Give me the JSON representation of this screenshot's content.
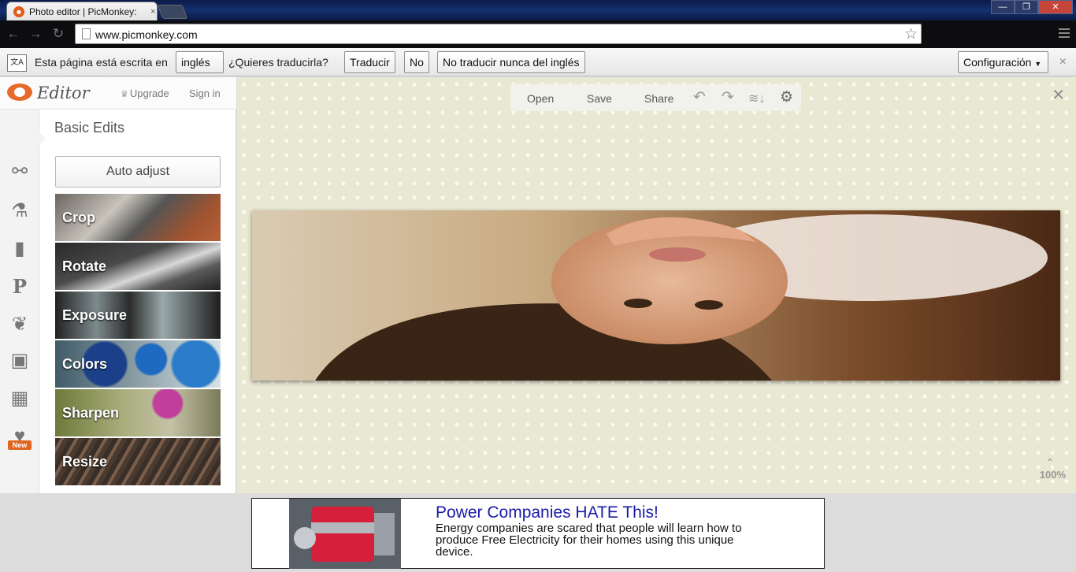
{
  "browser": {
    "tab_title": "Photo editor | PicMonkey:",
    "tab_close": "×",
    "url": "www.picmonkey.com",
    "window_buttons": [
      "—",
      "❐",
      "✕"
    ]
  },
  "translate_bar": {
    "prefix": "Esta página está escrita en",
    "language": "inglés",
    "question": "¿Quieres traducirla?",
    "translate_button": "Traducir",
    "no_button": "No",
    "never_button": "No traducir nunca del inglés",
    "settings_button": "Configuración",
    "close": "×"
  },
  "sidebar": {
    "brand": "Editor",
    "upgrade": "Upgrade",
    "signin": "Sign in",
    "new_badge": "New",
    "section_title": "Basic Edits",
    "auto_adjust": "Auto adjust",
    "tools": [
      {
        "label": "Crop"
      },
      {
        "label": "Rotate"
      },
      {
        "label": "Exposure"
      },
      {
        "label": "Colors"
      },
      {
        "label": "Sharpen"
      },
      {
        "label": "Resize"
      }
    ]
  },
  "canvas": {
    "toolbar": {
      "open": "Open",
      "save": "Save",
      "share": "Share"
    },
    "zoom": "100%"
  },
  "ad": {
    "title": "Power Companies HATE This!",
    "body": "Energy companies are scared that people will learn how to produce Free Electricity for their homes using this unique device."
  },
  "colors": {
    "accent": "#e0651f",
    "canvas_bg": "#e9e8d2",
    "ad_title": "#1a1aa8"
  }
}
